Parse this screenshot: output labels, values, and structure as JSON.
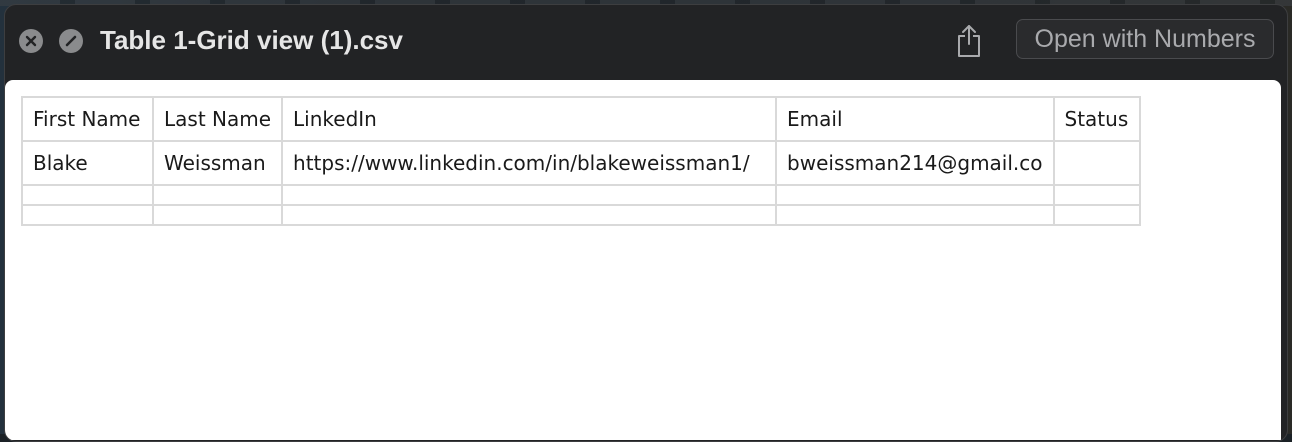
{
  "window": {
    "title": "Table 1-Grid view (1).csv",
    "open_button_label": "Open with Numbers"
  },
  "icons": {
    "close": "close-x-circle-icon",
    "mute": "slash-circle-icon",
    "share": "share-icon"
  },
  "table": {
    "headers": [
      "First Name",
      "Last Name",
      "LinkedIn",
      "Email",
      "Status"
    ],
    "rows": [
      [
        "Blake",
        "Weissman",
        "https://www.linkedin.com/in/blakeweissman1/",
        "bweissman214@gmail.co",
        ""
      ],
      [
        "",
        "",
        "",
        "",
        ""
      ],
      [
        "",
        "",
        "",
        "",
        ""
      ]
    ]
  },
  "colors": {
    "window_bg": "#222325",
    "content_bg": "#ffffff",
    "grid_line": "#d9d9d9",
    "title_text": "#e6e6e6"
  }
}
